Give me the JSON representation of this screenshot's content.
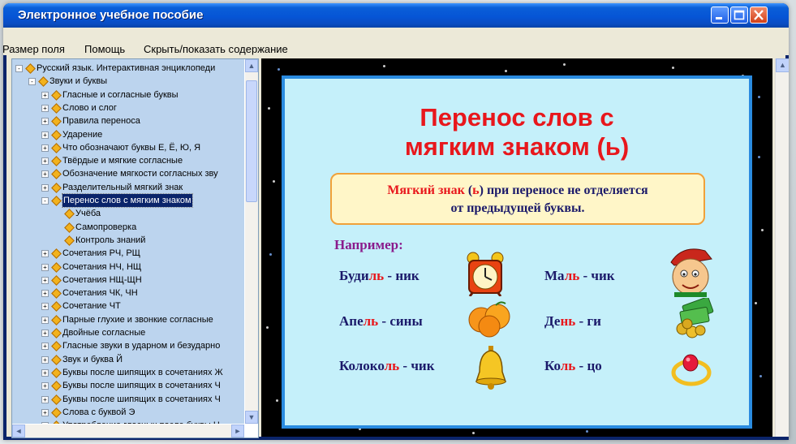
{
  "window": {
    "title": "Электронное учебное пособие",
    "buttons": {
      "minimize": "minimize",
      "maximize": "maximize",
      "close": "close"
    }
  },
  "menu": [
    {
      "label": "Размер поля"
    },
    {
      "label": "Помощь"
    },
    {
      "label": "Скрыть/показать содержание"
    }
  ],
  "tree": [
    {
      "label": "Русский язык. Интерактивная энциклопеди",
      "toggle": "-",
      "level": 0
    },
    {
      "label": "Звуки и буквы",
      "toggle": "-",
      "level": 1
    },
    {
      "label": "Гласные и согласные буквы",
      "toggle": "+",
      "level": 2
    },
    {
      "label": "Слово и слог",
      "toggle": "+",
      "level": 2
    },
    {
      "label": "Правила переноса",
      "toggle": "+",
      "level": 2
    },
    {
      "label": "Ударение",
      "toggle": "+",
      "level": 2
    },
    {
      "label": "Что обозначают буквы Е, Ё, Ю, Я",
      "toggle": "+",
      "level": 2
    },
    {
      "label": "Твёрдые и мягкие согласные",
      "toggle": "+",
      "level": 2
    },
    {
      "label": "Обозначение мягкости согласных зву",
      "toggle": "+",
      "level": 2
    },
    {
      "label": "Разделительный мягкий знак",
      "toggle": "+",
      "level": 2
    },
    {
      "label": "Перенос слов с мягким знаком",
      "toggle": "-",
      "level": 2,
      "selected": true
    },
    {
      "label": "Учёба",
      "toggle": "",
      "level": 3
    },
    {
      "label": "Самопроверка",
      "toggle": "",
      "level": 3
    },
    {
      "label": "Контроль знаний",
      "toggle": "",
      "level": 3
    },
    {
      "label": "Сочетания РЧ, РЩ",
      "toggle": "+",
      "level": 2
    },
    {
      "label": "Сочетания НЧ, НЩ",
      "toggle": "+",
      "level": 2
    },
    {
      "label": "Сочетания НЩ-ЩН",
      "toggle": "+",
      "level": 2
    },
    {
      "label": "Сочетания ЧК, ЧН",
      "toggle": "+",
      "level": 2
    },
    {
      "label": "Сочетание ЧТ",
      "toggle": "+",
      "level": 2
    },
    {
      "label": "Парные глухие и звонкие согласные",
      "toggle": "+",
      "level": 2
    },
    {
      "label": "Двойные согласные",
      "toggle": "+",
      "level": 2
    },
    {
      "label": "Гласные звуки в ударном и безударно",
      "toggle": "+",
      "level": 2
    },
    {
      "label": "Звук и буква Й",
      "toggle": "+",
      "level": 2
    },
    {
      "label": "Буквы после шипящих в сочетаниях Ж",
      "toggle": "+",
      "level": 2
    },
    {
      "label": "Буквы после шипящих в сочетаниях Ч",
      "toggle": "+",
      "level": 2
    },
    {
      "label": "Буквы после шипящих в сочетаниях Ч",
      "toggle": "+",
      "level": 2
    },
    {
      "label": "Слова с буквой Э",
      "toggle": "+",
      "level": 2
    },
    {
      "label": "Употребление гласных после буквы Ц",
      "toggle": "+",
      "level": 2
    }
  ],
  "slide": {
    "title_line1": "Перенос слов с",
    "title_line2": "мягким знаком (ь)",
    "rule_red": "Мягкий знак",
    "rule_mid": " (",
    "rule_sign": "ь",
    "rule_rest": ") при переносе не отделяется",
    "rule_line2": "от предыдущей буквы.",
    "example_label": "Например:",
    "words": [
      {
        "a": "Буди",
        "s": "ль",
        "b": " - ник"
      },
      {
        "a": "Ма",
        "s": "ль",
        "b": " - чик"
      },
      {
        "a": "Апе",
        "s": "ль",
        "b": " - сины"
      },
      {
        "a": "Де",
        "s": "нь",
        "b": " - ги"
      },
      {
        "a": "Колоко",
        "s": "ль",
        "b": " - чик"
      },
      {
        "a": "Ко",
        "s": "ль",
        "b": " - цо"
      }
    ]
  },
  "colors": {
    "accent": "#e8171c",
    "text_dark": "#1b1a6a",
    "example": "#8a1b8c",
    "tree_bg": "#bcd4ee"
  }
}
